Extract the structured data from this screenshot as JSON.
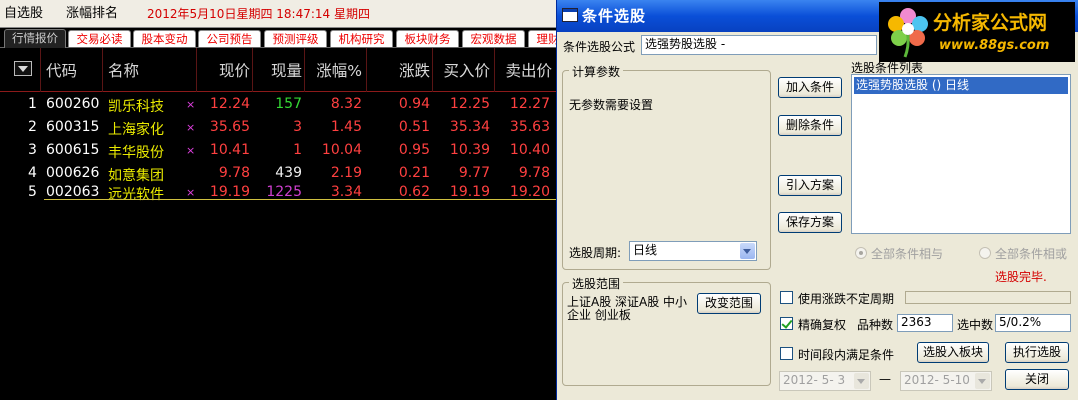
{
  "app": {
    "topbar": {
      "watchlist": "自选股",
      "ranking": "涨幅排名",
      "datetime": "2012年5月10日星期四  18:47:14 星期四"
    },
    "tabs": [
      "行情报价",
      "交易必读",
      "股本变动",
      "公司预告",
      "预测评级",
      "机构研究",
      "板块财务",
      "宏观数据",
      "理财"
    ],
    "columns": {
      "code": "代码",
      "name": "名称",
      "price": "现价",
      "volume": "现量",
      "pct": "涨幅%",
      "change": "涨跌",
      "bid": "买入价",
      "ask": "卖出价"
    },
    "rows": [
      {
        "idx": "1",
        "code": "600260",
        "name": "凯乐科技",
        "mark": "×",
        "price": "12.24",
        "volume": "157",
        "pct": "8.32",
        "change": "0.94",
        "bid": "12.25",
        "ask": "12.27"
      },
      {
        "idx": "2",
        "code": "600315",
        "name": "上海家化",
        "mark": "×",
        "price": "35.65",
        "volume": "3",
        "pct": "1.45",
        "change": "0.51",
        "bid": "35.34",
        "ask": "35.63"
      },
      {
        "idx": "3",
        "code": "600615",
        "name": "丰华股份",
        "mark": "×",
        "price": "10.41",
        "volume": "1",
        "pct": "10.04",
        "change": "0.95",
        "bid": "10.39",
        "ask": "10.40"
      },
      {
        "idx": "4",
        "code": "000626",
        "name": "如意集团",
        "mark": "",
        "price": "9.78",
        "volume": "439",
        "pct": "2.19",
        "change": "0.21",
        "bid": "9.77",
        "ask": "9.78"
      },
      {
        "idx": "5",
        "code": "002063",
        "name": "远光软件",
        "mark": "×",
        "price": "19.19",
        "volume": "1225",
        "pct": "3.34",
        "change": "0.62",
        "bid": "19.19",
        "ask": "19.20"
      }
    ]
  },
  "dialog": {
    "title": "条件选股",
    "formula_label": "条件选股公式",
    "formula_value": "选强势股选股 -",
    "logo_text": "分析家公式网",
    "logo_url": "www.88gs.com",
    "params_legend": "计算参数",
    "no_params": "无参数需要设置",
    "period_label": "选股周期:",
    "period_value": "日线",
    "range_legend": "选股范围",
    "range_value": "上证A股 深证A股 中小企业 创业板",
    "change_range": "改变范围",
    "add_cond": "加入条件",
    "del_cond": "删除条件",
    "import_plan": "引入方案",
    "save_plan": "保存方案",
    "list_label": "选股条件列表",
    "list_items": [
      "选强势股选股 () 日线"
    ],
    "radio_and": "全部条件相与",
    "radio_or": "全部条件相或",
    "status": "选股完毕.",
    "use_period": "使用涨跌不定周期",
    "exact_adjust": "精确复权",
    "count_label": "品种数",
    "count_value": "2363",
    "selected_label": "选中数",
    "selected_value": "5/0.2%",
    "time_range": "时间段内满足条件",
    "to_block": "选股入板块",
    "run": "执行选股",
    "date_from": "2012- 5- 3",
    "date_sep": "—",
    "date_to": "2012- 5-10",
    "close": "关闭"
  }
}
